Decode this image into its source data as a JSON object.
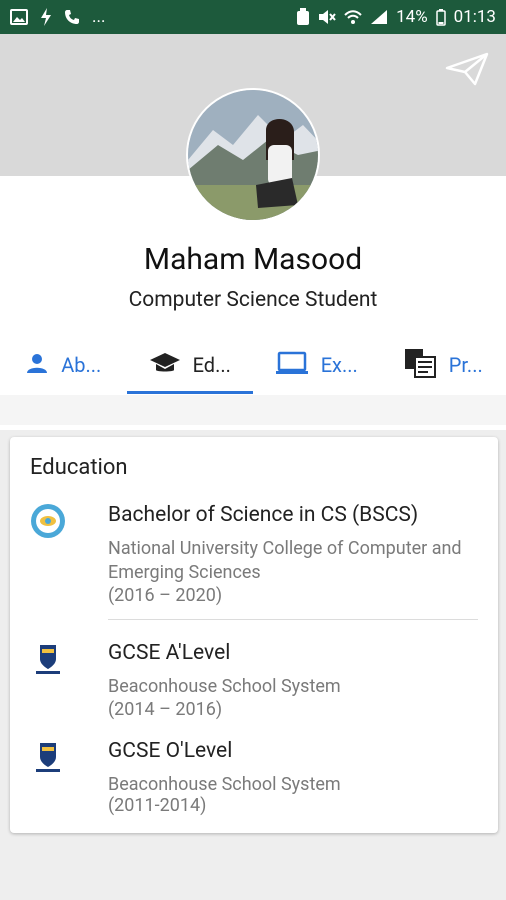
{
  "status_bar": {
    "left_icons": [
      "image-icon",
      "flash-icon",
      "phone-icon"
    ],
    "more": "...",
    "battery_percent": "14%",
    "time": "01:13"
  },
  "profile": {
    "name": "Maham Masood",
    "title": "Computer Science Student"
  },
  "tabs": [
    {
      "label": "Ab...",
      "icon": "person-icon"
    },
    {
      "label": "Ed...",
      "icon": "graduation-cap-icon"
    },
    {
      "label": "Ex...",
      "icon": "laptop-icon"
    },
    {
      "label": "Pr...",
      "icon": "copy-icon"
    }
  ],
  "active_tab": "Ed...",
  "education": {
    "title": "Education",
    "entries": [
      {
        "degree": "Bachelor of Science in CS (BSCS)",
        "institution": "National University College of Computer and Emerging Sciences",
        "years": "(2016 – 2020)"
      },
      {
        "degree": "GCSE A'Level",
        "institution": "Beaconhouse School System",
        "years": "(2014 – 2016)"
      },
      {
        "degree": "GCSE O'Level",
        "institution": "Beaconhouse School System",
        "years": "(2011-2014)"
      }
    ]
  },
  "colors": {
    "status_bar": "#1d5a3c",
    "accent": "#2a73d8",
    "header_bg": "#d9d9d9"
  }
}
